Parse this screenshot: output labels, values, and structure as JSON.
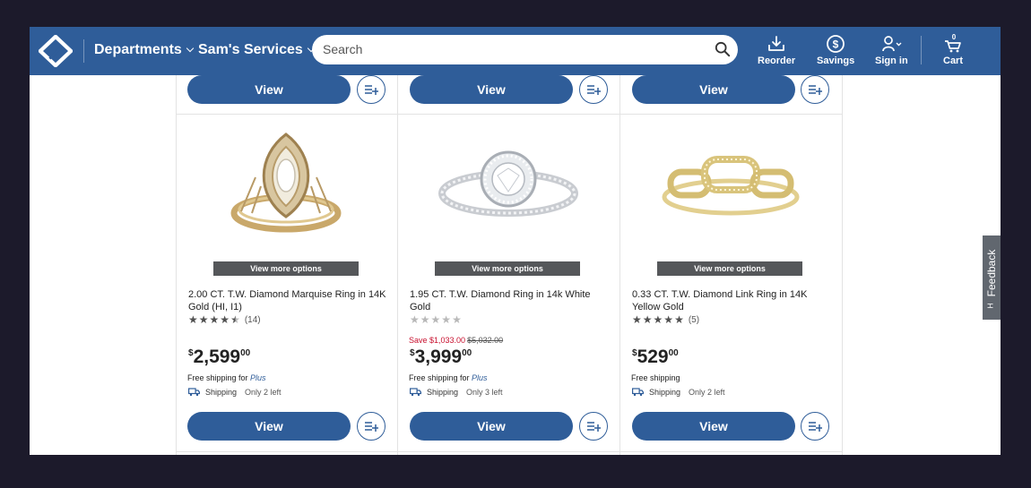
{
  "header": {
    "departments_label": "Departments",
    "services_label": "Sam's Services",
    "search_placeholder": "Search",
    "reorder_label": "Reorder",
    "savings_label": "Savings",
    "signin_label": "Sign in",
    "cart_label": "Cart",
    "cart_count": "0",
    "brand_color": "#2f5d99"
  },
  "top_row": {
    "view_labels": [
      "View",
      "View",
      "View"
    ]
  },
  "products": [
    {
      "more_options": "View more options",
      "title": "2.00 CT. T.W. Diamond Marquise Ring in 14K Gold (HI, I1)",
      "rating": 4.5,
      "review_count": "(14)",
      "price_currency": "$",
      "price_dollars": "2,599",
      "price_cents": "00",
      "shipping_prefix": "Free shipping for ",
      "shipping_plus": "Plus",
      "ship_label": "Shipping",
      "stock_left": "Only 2 left",
      "view_label": "View"
    },
    {
      "more_options": "View more options",
      "title": "1.95 CT. T.W. Diamond Ring in 14k White Gold",
      "rating": 0,
      "save_text": "Save $1,033.00",
      "was_price": "$5,032.00",
      "price_currency": "$",
      "price_dollars": "3,999",
      "price_cents": "00",
      "shipping_prefix": "Free shipping for ",
      "shipping_plus": "Plus",
      "ship_label": "Shipping",
      "stock_left": "Only 3 left",
      "view_label": "View"
    },
    {
      "more_options": "View more options",
      "title": "0.33 CT. T.W. Diamond Link Ring in 14K Yellow Gold",
      "rating": 5,
      "review_count": "(5)",
      "price_currency": "$",
      "price_dollars": "529",
      "price_cents": "00",
      "shipping_prefix": "Free shipping",
      "ship_label": "Shipping",
      "stock_left": "Only 2 left",
      "view_label": "View"
    }
  ],
  "feedback_label": "Feedback",
  "feedback_icon": "H"
}
